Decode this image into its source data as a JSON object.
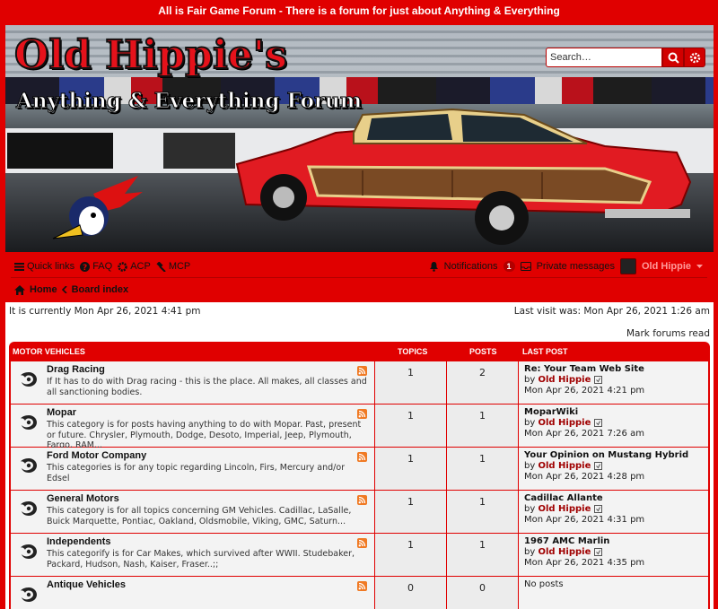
{
  "site": {
    "tagline": "All is Fair Game Forum - There is a forum for just about Anything & Everything",
    "logo_line1": "Old Hippie's",
    "logo_line2": "Anything & Everything Forum"
  },
  "search": {
    "placeholder": "Search…"
  },
  "nav": {
    "quick_links": "Quick links",
    "faq": "FAQ",
    "acp": "ACP",
    "mcp": "MCP",
    "notifications": "Notifications",
    "notifications_count": "1",
    "private_messages": "Private messages",
    "username": "Old Hippie",
    "home": "Home",
    "board_index": "Board index"
  },
  "info": {
    "current_time": "It is currently Mon Apr 26, 2021 4:41 pm",
    "last_visit": "Last visit was: Mon Apr 26, 2021 1:26 am",
    "mark_read": "Mark forums read"
  },
  "table": {
    "category": "MOTOR VEHICLES",
    "col_topics": "TOPICS",
    "col_posts": "POSTS",
    "col_last": "LAST POST",
    "by": "by",
    "rows": [
      {
        "title": "Drag Racing",
        "desc": "If It has to do with Drag racing - this is the place. All makes, all classes and all sanctioning bodies.",
        "topics": "1",
        "posts": "2",
        "last_title": "Re: Your Team Web Site",
        "last_author": "Old Hippie",
        "last_date": "Mon Apr 26, 2021 4:21 pm"
      },
      {
        "title": "Mopar",
        "desc": "This category is for posts having anything to do with Mopar. Past, present or future. Chrysler, Plymouth, Dodge, Desoto, Imperial, Jeep, Plymouth, Fargo, RAM...",
        "topics": "1",
        "posts": "1",
        "last_title": "MoparWiki",
        "last_author": "Old Hippie",
        "last_date": "Mon Apr 26, 2021 7:26 am"
      },
      {
        "title": "Ford Motor Company",
        "desc": "This categories is for any topic regarding Lincoln, Firs, Mercury and/or Edsel",
        "topics": "1",
        "posts": "1",
        "last_title": "Your Opinion on Mustang Hybrid",
        "last_author": "Old Hippie",
        "last_date": "Mon Apr 26, 2021 4:28 pm"
      },
      {
        "title": "General Motors",
        "desc": "This category is for all topics concerning GM Vehicles. Cadillac, LaSalle, Buick Marquette, Pontiac, Oakland, Oldsmobile, Viking, GMC, Saturn...",
        "topics": "1",
        "posts": "1",
        "last_title": "Cadillac Allante",
        "last_author": "Old Hippie",
        "last_date": "Mon Apr 26, 2021 4:31 pm"
      },
      {
        "title": "Independents",
        "desc": "This categorify is for Car Makes, which survived after WWII. Studebaker, Packard, Hudson, Nash, Kaiser, Fraser..;;",
        "topics": "1",
        "posts": "1",
        "last_title": "1967 AMC Marlin",
        "last_author": "Old Hippie",
        "last_date": "Mon Apr 26, 2021 4:35 pm"
      },
      {
        "title": "Antique Vehicles",
        "desc": "",
        "topics": "0",
        "posts": "0",
        "last_title": "",
        "last_author": "",
        "last_date": "No posts"
      }
    ]
  }
}
